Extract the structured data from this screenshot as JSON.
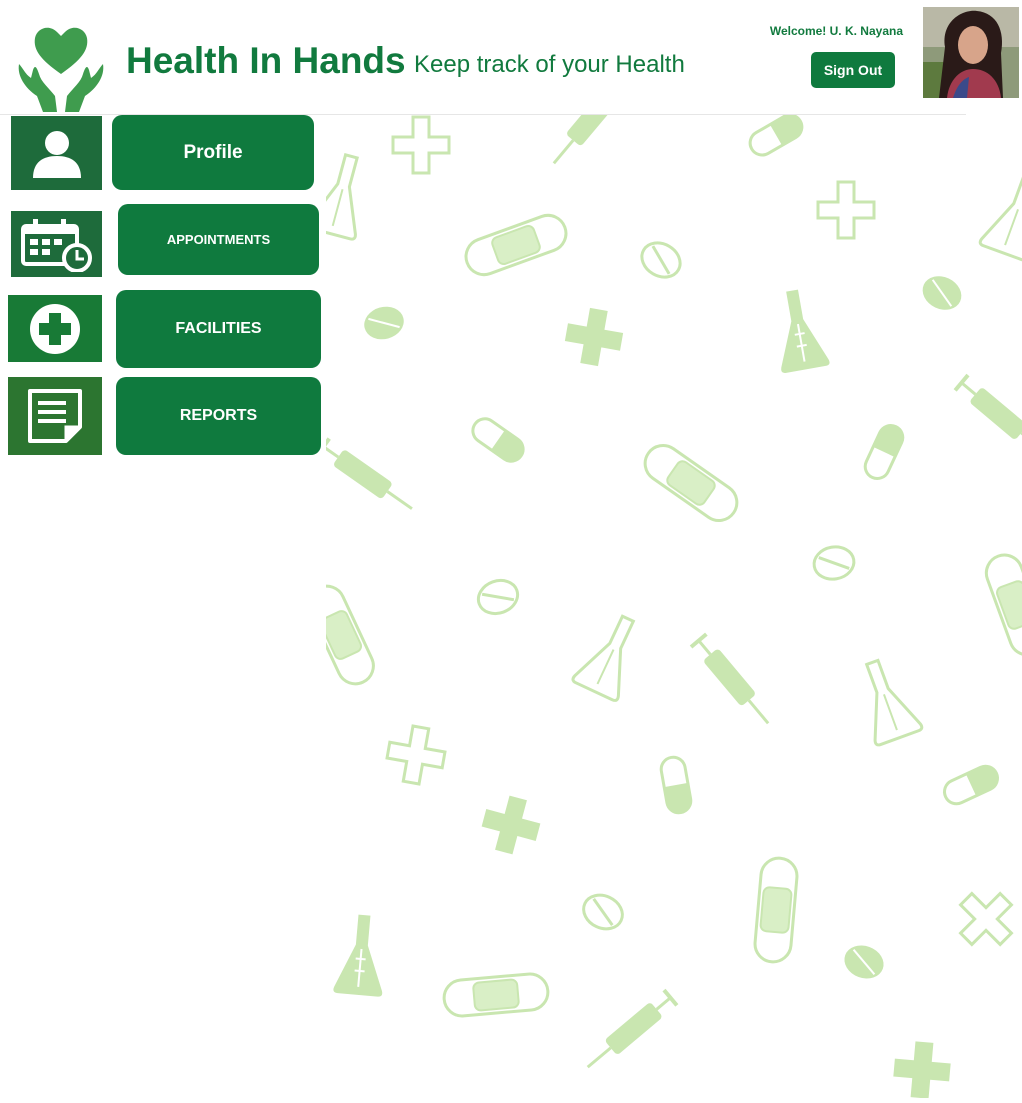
{
  "header": {
    "app_title": "Health In Hands",
    "tagline": "Keep track of your Health",
    "welcome": "Welcome! U. K. Nayana",
    "sign_out_label": "Sign Out"
  },
  "nav": [
    {
      "label": "Profile",
      "icon": "user-icon"
    },
    {
      "label": "APPOINTMENTS",
      "icon": "calendar-clock-icon"
    },
    {
      "label": "FACILITIES",
      "icon": "medical-cross-icon"
    },
    {
      "label": "REPORTS",
      "icon": "document-icon"
    }
  ],
  "colors": {
    "brand_green": "#0f7a3e",
    "pattern_green": "#c9e6b0",
    "logo_green": "#3f9c4e"
  }
}
